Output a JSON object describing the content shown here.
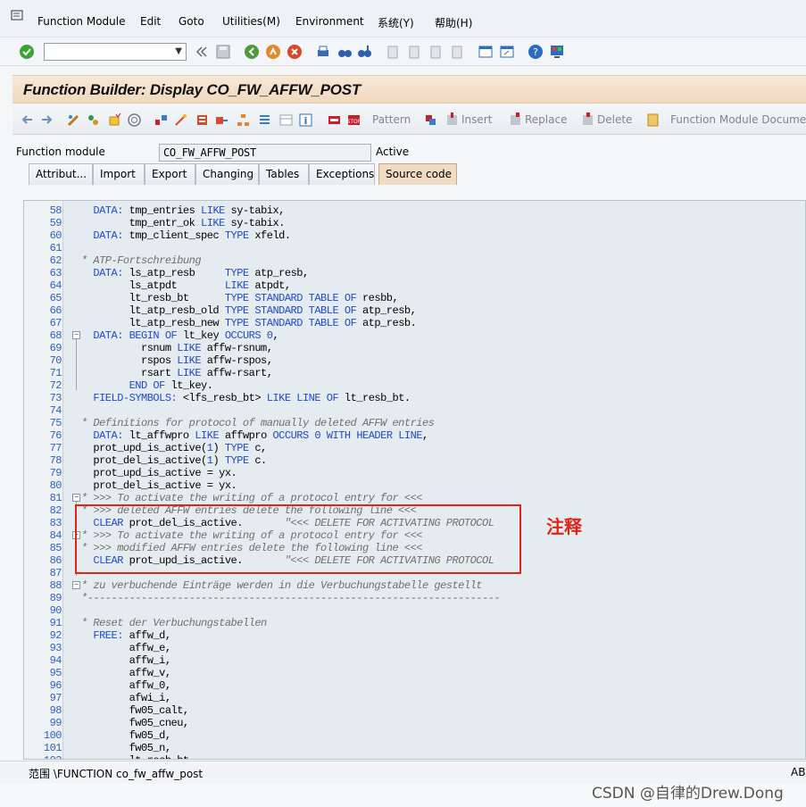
{
  "menubar": {
    "items": [
      "Function Module",
      "Edit",
      "Goto",
      "Utilities(M)",
      "Environment",
      "系统(Y)",
      "帮助(H)"
    ]
  },
  "toolbar": {
    "command_value": ""
  },
  "title": "Function Builder: Display CO_FW_AFFW_POST",
  "app_toolbar": {
    "pattern": "Pattern",
    "insert": "Insert",
    "replace": "Replace",
    "delete": "Delete",
    "docu": "Function Module Documentation"
  },
  "function_module": {
    "label": "Function module",
    "value": "CO_FW_AFFW_POST",
    "status": "Active"
  },
  "tabs": [
    "Attribut...",
    "Import",
    "Export",
    "Changing",
    "Tables",
    "Exceptions",
    "Source code"
  ],
  "code_lines": [
    {
      "n": "58",
      "t": "  DATA: tmp_entries LIKE sy-tabix,"
    },
    {
      "n": "59",
      "t": "        tmp_entr_ok LIKE sy-tabix."
    },
    {
      "n": "60",
      "t": "  DATA: tmp_client_spec TYPE xfeld."
    },
    {
      "n": "61",
      "t": ""
    },
    {
      "n": "62",
      "t": "* ATP-Fortschreibung"
    },
    {
      "n": "63",
      "t": "  DATA: ls_atp_resb     TYPE atp_resb,"
    },
    {
      "n": "64",
      "t": "        ls_atpdt        LIKE atpdt,"
    },
    {
      "n": "65",
      "t": "        lt_resb_bt      TYPE STANDARD TABLE OF resbb,"
    },
    {
      "n": "66",
      "t": "        lt_atp_resb_old TYPE STANDARD TABLE OF atp_resb,"
    },
    {
      "n": "67",
      "t": "        lt_atp_resb_new TYPE STANDARD TABLE OF atp_resb."
    },
    {
      "n": "68",
      "t": "  DATA: BEGIN OF lt_key OCCURS 0,"
    },
    {
      "n": "69",
      "t": "          rsnum LIKE affw-rsnum,"
    },
    {
      "n": "70",
      "t": "          rspos LIKE affw-rspos,"
    },
    {
      "n": "71",
      "t": "          rsart LIKE affw-rsart,"
    },
    {
      "n": "72",
      "t": "        END OF lt_key."
    },
    {
      "n": "73",
      "t": "  FIELD-SYMBOLS: <lfs_resb_bt> LIKE LINE OF lt_resb_bt."
    },
    {
      "n": "74",
      "t": ""
    },
    {
      "n": "75",
      "t": "* Definitions for protocol of manually deleted AFFW entries"
    },
    {
      "n": "76",
      "t": "  DATA: lt_affwpro LIKE affwpro OCCURS 0 WITH HEADER LINE,"
    },
    {
      "n": "77",
      "t": "  prot_upd_is_active(1) TYPE c,"
    },
    {
      "n": "78",
      "t": "  prot_del_is_active(1) TYPE c."
    },
    {
      "n": "79",
      "t": "  prot_upd_is_active = yx."
    },
    {
      "n": "80",
      "t": "  prot_del_is_active = yx."
    },
    {
      "n": "81",
      "t": "* >>> To activate the writing of a protocol entry for <<<"
    },
    {
      "n": "82",
      "t": "* >>> deleted AFFW entries delete the following line <<<"
    },
    {
      "n": "83",
      "t": "  CLEAR prot_del_is_active.       \"<<< DELETE FOR ACTIVATING PROTOCOL"
    },
    {
      "n": "84",
      "t": "* >>> To activate the writing of a protocol entry for <<<"
    },
    {
      "n": "85",
      "t": "* >>> modified AFFW entries delete the following line <<<"
    },
    {
      "n": "86",
      "t": "  CLEAR prot_upd_is_active.       \"<<< DELETE FOR ACTIVATING PROTOCOL"
    },
    {
      "n": "87",
      "t": ""
    },
    {
      "n": "88",
      "t": "* zu verbuchende Einträge werden in die Verbuchungstabelle gestellt"
    },
    {
      "n": "89",
      "t": "*---------------------------------------------------------------------"
    },
    {
      "n": "90",
      "t": ""
    },
    {
      "n": "91",
      "t": "* Reset der Verbuchungstabellen"
    },
    {
      "n": "92",
      "t": "  FREE: affw_d,"
    },
    {
      "n": "93",
      "t": "        affw_e,"
    },
    {
      "n": "94",
      "t": "        affw_i,"
    },
    {
      "n": "95",
      "t": "        affw_v,"
    },
    {
      "n": "96",
      "t": "        affw_0,"
    },
    {
      "n": "97",
      "t": "        afwi_i,"
    },
    {
      "n": "98",
      "t": "        fw05_calt,"
    },
    {
      "n": "99",
      "t": "        fw05_cneu,"
    },
    {
      "n": "100",
      "t": "        fw05_d,"
    },
    {
      "n": "101",
      "t": "        fw05_n,"
    },
    {
      "n": "102",
      "t": "        lt_resb_bt,"
    }
  ],
  "annotation": "注释",
  "statusbar": {
    "scope": "范围 \\FUNCTION co_fw_affw_post",
    "right": "AB"
  },
  "watermark": "CSDN @自律的Drew.Dong",
  "colors": {
    "highlight": "#e2231a",
    "keyword": "#1f47d8",
    "line_number": "#2a61c9",
    "title_band": "#f1dcc3"
  }
}
